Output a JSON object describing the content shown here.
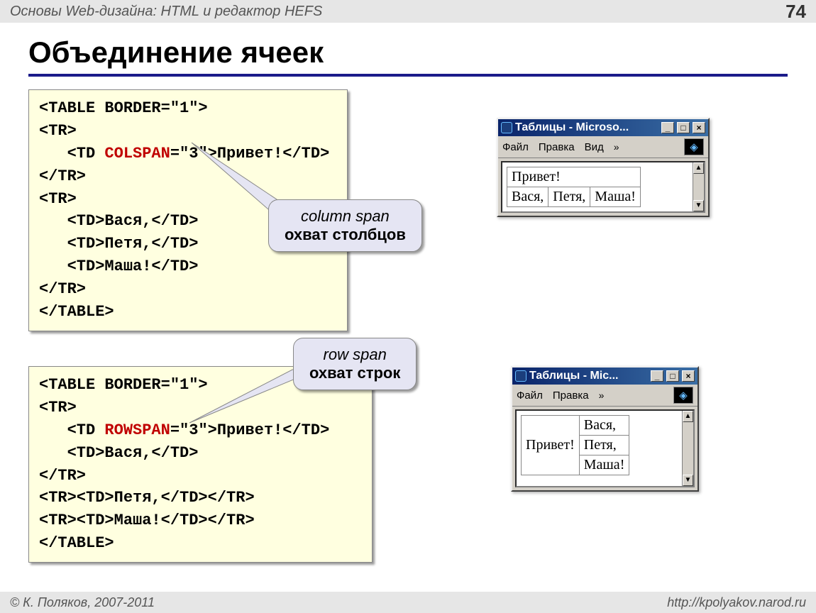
{
  "header": {
    "title": "Основы Web-дизайна: HTML и редактор HEFS",
    "page": "74"
  },
  "slide_title": "Объединение ячеек",
  "code1": {
    "l1": "<TABLE BORDER=\"1\">",
    "l2": "<TR>",
    "l3a": "   <TD ",
    "l3red": "COLSPAN",
    "l3b": "=\"3\">Привет!</TD>",
    "l4": "</TR>",
    "l5": "<TR>",
    "l6": "   <TD>Вася,</TD>",
    "l7": "   <TD>Петя,</TD>",
    "l8": "   <TD>Маша!</TD>",
    "l9": "</TR>",
    "l10": "</TABLE>"
  },
  "callout1": {
    "line1": "column span",
    "line2": "охват столбцов"
  },
  "code2": {
    "l1": "<TABLE BORDER=\"1\">",
    "l2": "<TR>",
    "l3a": "   <TD ",
    "l3red": "ROWSPAN",
    "l3b": "=\"3\">Привет!</TD>",
    "l4": "   <TD>Вася,</TD>",
    "l5": "</TR>",
    "l6": "<TR><TD>Петя,</TD></TR>",
    "l7": "<TR><TD>Маша!</TD></TR>",
    "l8": "</TABLE>"
  },
  "callout2": {
    "line1": "row span",
    "line2": "охват строк"
  },
  "win1": {
    "title": "Таблицы - Microso...",
    "menu": {
      "file": "Файл",
      "edit": "Правка",
      "view": "Вид",
      "more": "»"
    },
    "table": {
      "top": "Привет!",
      "c1": "Вася,",
      "c2": "Петя,",
      "c3": "Маша!"
    }
  },
  "win2": {
    "title": "Таблицы - Mic...",
    "menu": {
      "file": "Файл",
      "edit": "Правка",
      "more": "»"
    },
    "table": {
      "left": "Привет!",
      "r1": "Вася,",
      "r2": "Петя,",
      "r3": "Маша!"
    }
  },
  "win_btns": {
    "min": "_",
    "max": "□",
    "close": "×"
  },
  "scroll": {
    "up": "▲",
    "down": "▼"
  },
  "footer": {
    "left": "© К. Поляков, 2007-2011",
    "right": "http://kpolyakov.narod.ru"
  }
}
